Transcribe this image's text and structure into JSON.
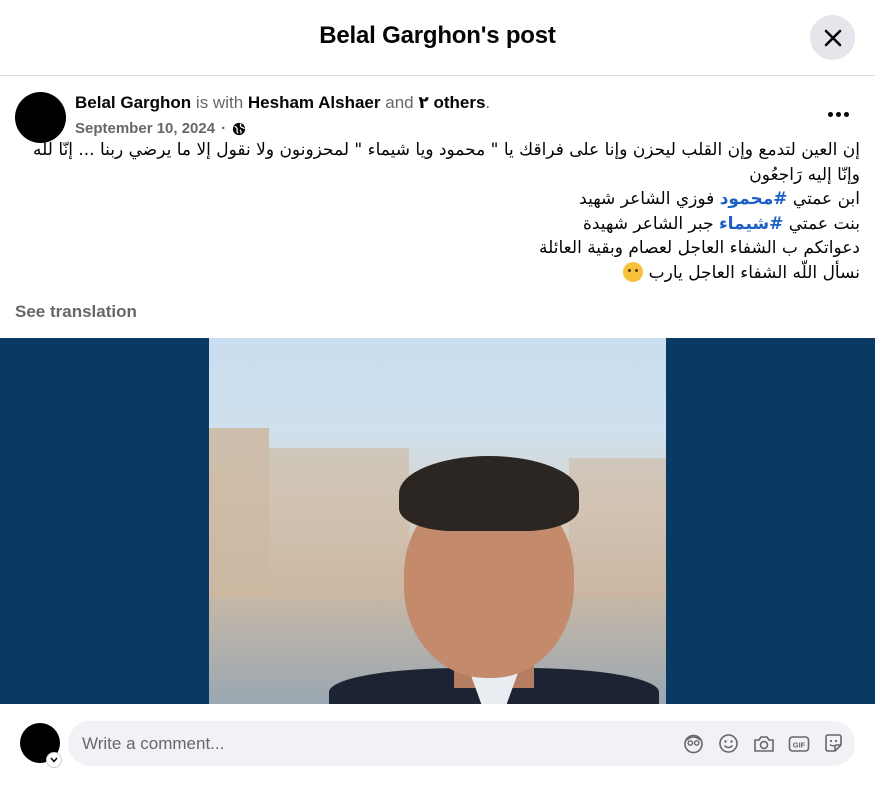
{
  "header": {
    "title": "Belal Garghon's post"
  },
  "post": {
    "author": "Belal Garghon",
    "with_text": "is with",
    "tagged": "Hesham Alshaer",
    "and_text": "and",
    "others": "٢ others",
    "date": "September 10, 2024",
    "privacy_icon": "globe-icon",
    "text_lines": [
      "إن العين لتدمع وإن القلب ليحزن وإنا على فراقك يا \" محمود  ويا شيماء \" لمحزونون ولا نقول إلا ما يرضي ربنا ... إنّا للّه وإنّا إليه رَاجعُون",
      "ابن عمتي ",
      "#محمود",
      " فوزي الشاعر شهيد",
      "بنت عمتي  ",
      "#شيماء",
      " جبر الشاعر شهيدة",
      "دعواتكم  ب الشفاء العاجل لعصام وبقية العائلة",
      "نسأل اللّه الشفاء العاجل يارب "
    ],
    "see_translation": "See translation"
  },
  "comment": {
    "placeholder": "Write a comment...",
    "icons": [
      "avatar-sticker-icon",
      "emoji-icon",
      "camera-icon",
      "gif-icon",
      "sticker-icon"
    ]
  },
  "colors": {
    "hashtag": "#1c5fc6",
    "media_background": "#083a63",
    "muted_text": "#65676b"
  }
}
